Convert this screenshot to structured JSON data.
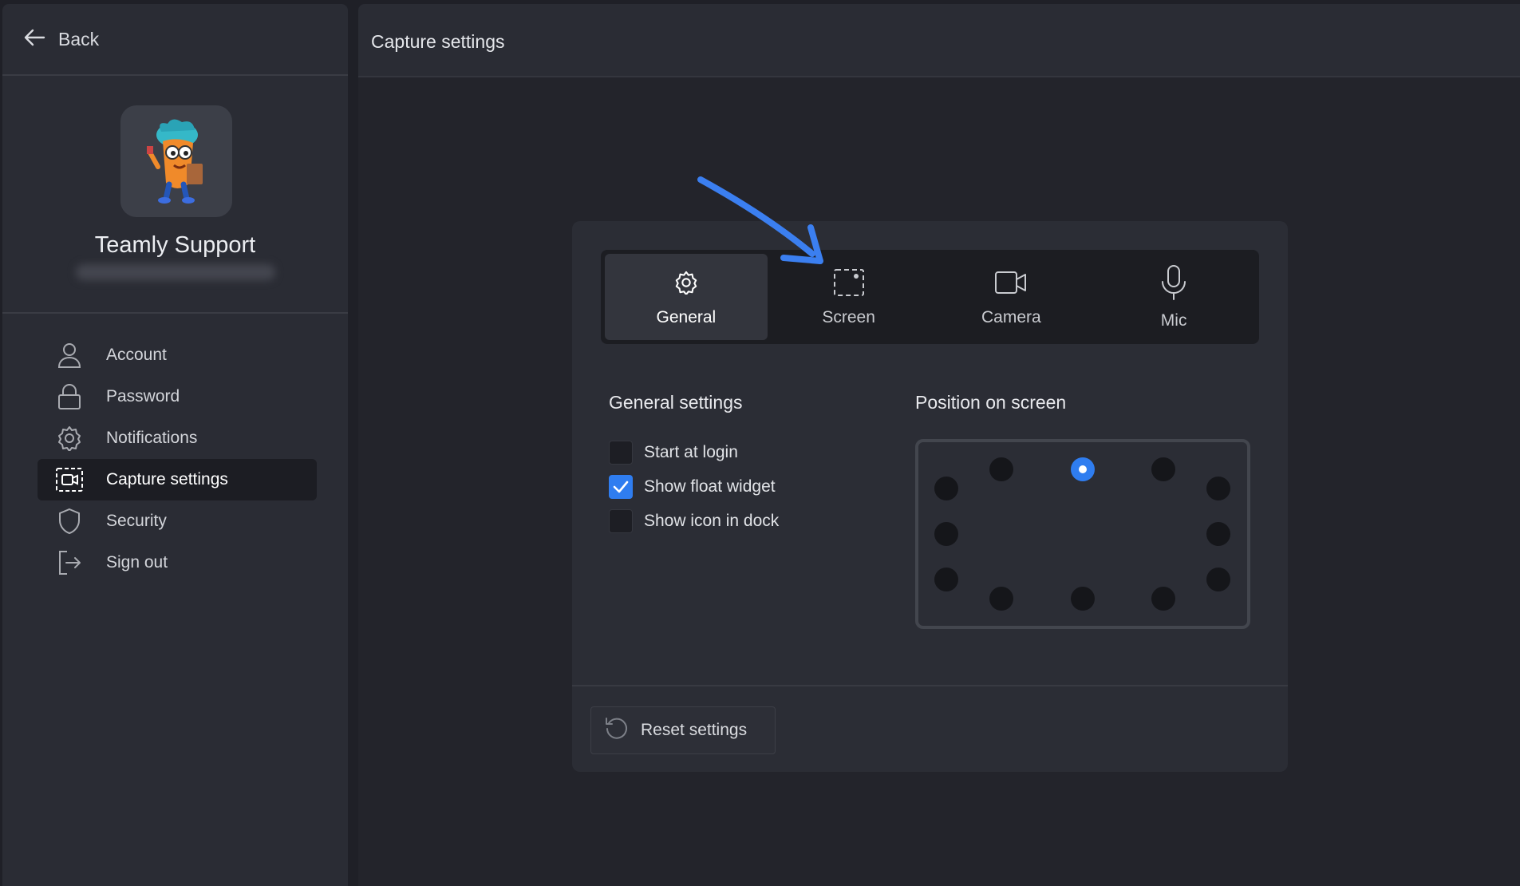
{
  "sidebar": {
    "back_label": "Back",
    "user_name": "Teamly Support",
    "items": [
      {
        "label": "Account",
        "icon": "user-icon"
      },
      {
        "label": "Password",
        "icon": "lock-icon"
      },
      {
        "label": "Notifications",
        "icon": "gear-icon"
      },
      {
        "label": "Capture settings",
        "icon": "capture-icon",
        "active": true
      },
      {
        "label": "Security",
        "icon": "shield-icon"
      },
      {
        "label": "Sign out",
        "icon": "sign-out-icon"
      }
    ]
  },
  "main": {
    "title": "Capture settings"
  },
  "tabs": [
    {
      "label": "General",
      "icon": "gear-icon",
      "active": true
    },
    {
      "label": "Screen",
      "icon": "screen-select-icon"
    },
    {
      "label": "Camera",
      "icon": "camera-icon"
    },
    {
      "label": "Mic",
      "icon": "mic-icon"
    }
  ],
  "general": {
    "title": "General settings",
    "options": [
      {
        "label": "Start at login",
        "checked": false
      },
      {
        "label": "Show float widget",
        "checked": true
      },
      {
        "label": "Show icon in dock",
        "checked": false
      }
    ]
  },
  "position": {
    "title": "Position on screen",
    "selected": "top-center"
  },
  "reset_label": "Reset settings",
  "colors": {
    "accent": "#2f7df0",
    "annotation_arrow": "#3b7ff0"
  }
}
